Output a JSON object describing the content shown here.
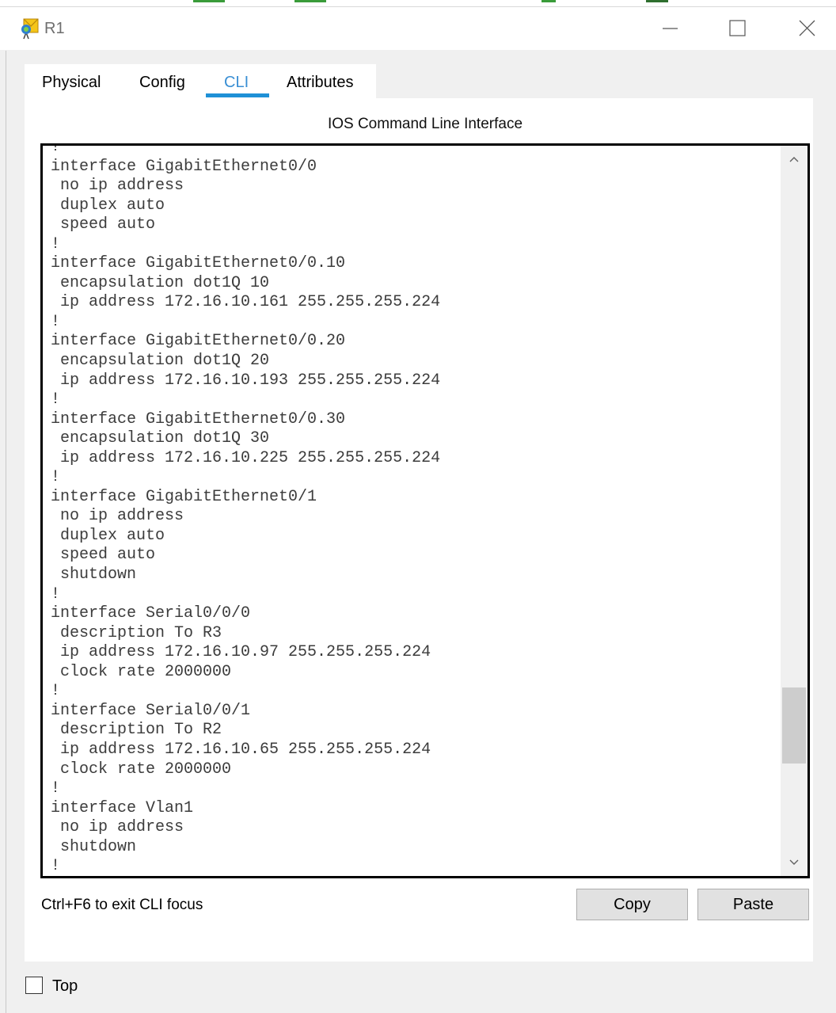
{
  "window": {
    "title": "R1"
  },
  "tabs": [
    {
      "label": "Physical"
    },
    {
      "label": "Config"
    },
    {
      "label": "CLI"
    },
    {
      "label": "Attributes"
    }
  ],
  "cli": {
    "header": "IOS Command Line Interface",
    "text": "!\ninterface GigabitEthernet0/0\n no ip address\n duplex auto\n speed auto\n!\ninterface GigabitEthernet0/0.10\n encapsulation dot1Q 10\n ip address 172.16.10.161 255.255.255.224\n!\ninterface GigabitEthernet0/0.20\n encapsulation dot1Q 20\n ip address 172.16.10.193 255.255.255.224\n!\ninterface GigabitEthernet0/0.30\n encapsulation dot1Q 30\n ip address 172.16.10.225 255.255.255.224\n!\ninterface GigabitEthernet0/1\n no ip address\n duplex auto\n speed auto\n shutdown\n!\ninterface Serial0/0/0\n description To R3\n ip address 172.16.10.97 255.255.255.224\n clock rate 2000000\n!\ninterface Serial0/0/1\n description To R2\n ip address 172.16.10.65 255.255.255.224\n clock rate 2000000\n!\ninterface Vlan1\n no ip address\n shutdown\n!"
  },
  "footer": {
    "status": "Ctrl+F6 to exit CLI focus",
    "copy_label": "Copy",
    "paste_label": "Paste",
    "top_checkbox_label": "Top",
    "top_checked": false
  },
  "colors": {
    "active_tab_text": "#3a8fd4",
    "active_tab_underline": "#1e90d6"
  }
}
